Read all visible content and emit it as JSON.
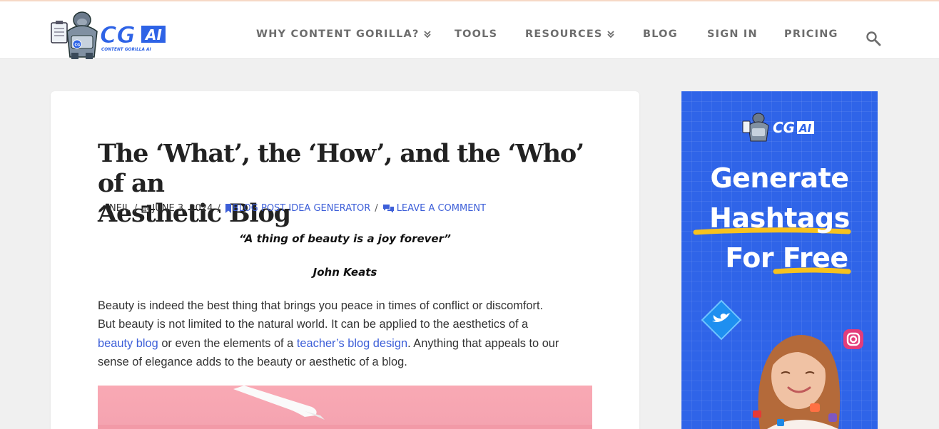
{
  "brand": {
    "logo_text": "CG",
    "logo_suffix": "AI",
    "logo_tagline": "CONTENT GORILLA AI"
  },
  "nav": {
    "items": [
      {
        "label": "WHY CONTENT GORILLA?",
        "has_dropdown": true
      },
      {
        "label": "TOOLS",
        "has_dropdown": false
      },
      {
        "label": "RESOURCES",
        "has_dropdown": true
      },
      {
        "label": "BLOG",
        "has_dropdown": false
      },
      {
        "label": "SIGN IN",
        "has_dropdown": false
      },
      {
        "label": "PRICING",
        "has_dropdown": false
      }
    ],
    "search_icon": "search-icon"
  },
  "article": {
    "title_line1": "The ‘What’, the ‘How’, and the ‘Who’ of an",
    "title_line2": "Aesthetic Blog",
    "meta": {
      "author": "NEIL",
      "date": "JUNE 3, 2024",
      "category": "BLOG POST IDEA GENERATOR",
      "comment": "LEAVE A COMMENT"
    },
    "quote": "“A thing of beauty is a joy forever”",
    "quote_author": "John Keats",
    "para": {
      "line1": "Beauty is indeed the best thing that brings you peace in times of conflict or discomfort.",
      "line2": "But beauty is not limited to the natural world. It can be applied to the aesthetics of a",
      "link1": "beauty blog",
      "text_mid": " or even the elements of a ",
      "link2": "teacher’s blog design",
      "text_end": ". Anything that appeals to our",
      "line4": "sense of elegance adds to the beauty or aesthetic of a blog."
    }
  },
  "ad": {
    "logo_text": "CG",
    "logo_suffix": "AI",
    "line1": "Generate",
    "line2": "Hashtags",
    "line3_a": "For ",
    "line3_b": "Free",
    "accent": "#f7c21e",
    "background": "#2f64e8"
  },
  "colors": {
    "link": "#3d5fd8",
    "nav_text": "#6d6d6d",
    "page_bg": "#f0f0f0"
  }
}
